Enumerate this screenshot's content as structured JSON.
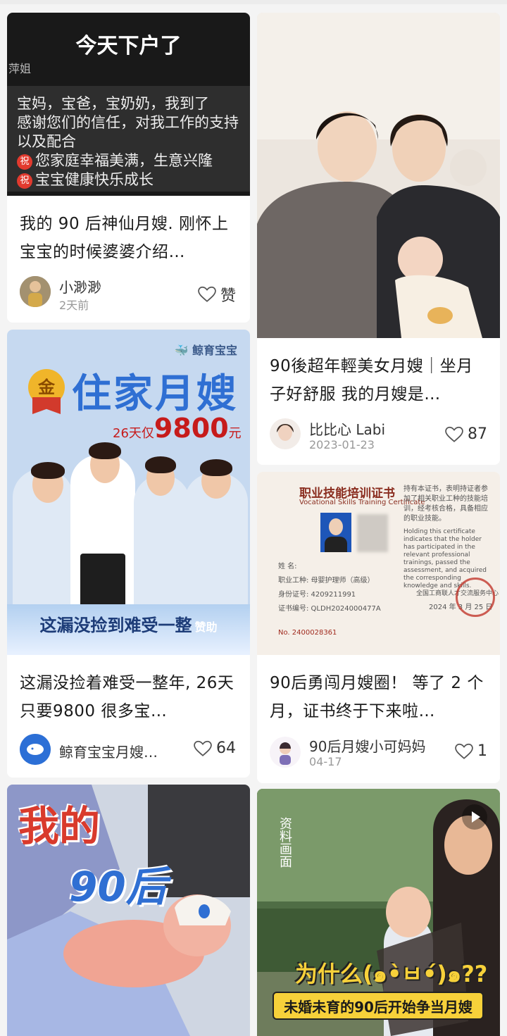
{
  "feed": [
    {
      "cover": {
        "headline": "今天下户了",
        "tag": "萍姐",
        "lines": [
          "宝妈，宝爸，宝奶奶，我到了",
          "感谢您们的信任，对我工作的支持",
          "以及配合"
        ],
        "wishes": [
          "您家庭幸福美满，生意兴隆",
          "宝宝健康快乐成长"
        ],
        "wish_badge": "祝"
      },
      "title": "我的 90 后神仙月嫂. 刚怀上宝宝的时候婆婆介绍…",
      "author": "小渺渺",
      "date": "2天前",
      "likes": "赞"
    },
    {
      "title": "90後超年輕美女月嫂｜坐月子好舒服 我的月嫂是…",
      "author": "比比心 Labi",
      "date": "2023-01-23",
      "likes": "87"
    },
    {
      "cover": {
        "brand": "鲸育宝宝",
        "medal": "金",
        "headline": "住家月嫂",
        "price_prefix": "26天仅",
        "price_value": "9800",
        "price_unit": "元",
        "bottom": "这漏没捡到难受一整",
        "sponsored": "赞助"
      },
      "title": "这漏没捡着难受一整年, 26天只要9800 很多宝…",
      "author": "鲸育宝宝月嫂…",
      "likes": "64"
    },
    {
      "cover": {
        "cert_title": "职业技能培训证书",
        "cert_subtitle": "Vocational Skills Training Certificate",
        "fields": [
          "姓 名:",
          "职业工种: 母婴护理师（高级）",
          "身份证号: 4209211991",
          "证书编号: QLDH2024000477A"
        ],
        "serial": "No. 2400028361",
        "issuer": "全国工商联人才交流服务中心",
        "issue_date": "2024 年 3 月 25 日",
        "text_cn": "持有本证书，表明持证者参加了相关职业工种的技能培训，经考核合格，具备相应的职业技能。",
        "text_en": "Holding this certificate indicates that the holder has participated in the relevant professional trainings, passed the assessment, and acquired the corresponding knowledge and skills."
      },
      "title": "90后勇闯月嫂圈！ 等了 2 个月，证书终于下来啦…",
      "author": "90后月嫂小可妈妈",
      "date": "04-17",
      "likes": "1"
    },
    {
      "cover": {
        "line1": "我的",
        "line2": "90后"
      }
    },
    {
      "cover": {
        "side": "资料画面",
        "caption1": "为什么(๑•̀ㅂ•́)๑??",
        "caption2": "未婚未育的90后开始争当月嫂"
      }
    }
  ],
  "colors": {
    "heart": "#555555",
    "accent_red": "#e23a2e",
    "brand_blue": "#2f6fd3"
  }
}
